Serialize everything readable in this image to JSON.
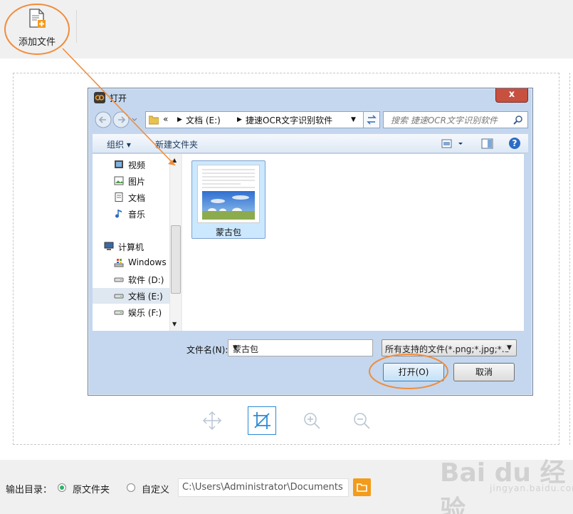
{
  "toolbar": {
    "add_file_label": "添加文件"
  },
  "dialog": {
    "title": "打开",
    "close_label": "x",
    "address": {
      "prefix": "«",
      "drive": "文档 (E:)",
      "folder": "捷速OCR文字识别软件"
    },
    "search_placeholder": "搜索 捷速OCR文字识别软件",
    "organize_label": "组织 ▾",
    "new_folder_label": "新建文件夹",
    "nav_items": [
      {
        "label": "视频",
        "icon": "video-icon"
      },
      {
        "label": "图片",
        "icon": "picture-icon"
      },
      {
        "label": "文档",
        "icon": "document-icon"
      },
      {
        "label": "音乐",
        "icon": "music-icon"
      },
      {
        "label": "计算机",
        "icon": "computer-icon"
      },
      {
        "label": "Windows",
        "icon": "windows-drive-icon"
      },
      {
        "label": "软件 (D:)",
        "icon": "drive-icon"
      },
      {
        "label": "文档 (E:)",
        "icon": "drive-icon",
        "selected": true
      },
      {
        "label": "娱乐 (F:)",
        "icon": "drive-icon"
      }
    ],
    "file": {
      "name": "蒙古包"
    },
    "filename_label": "文件名(N):",
    "filename_value": "蒙古包",
    "filter_value": "所有支持的文件(*.png;*.jpg;*.b",
    "open_button": "打开(O)",
    "cancel_button": "取消"
  },
  "bottom": {
    "output_label": "输出目录：",
    "option_original": "原文件夹",
    "option_custom": "自定义",
    "selected_option": "原文件夹",
    "path_value": "C:\\Users\\Administrator\\Documents"
  },
  "watermark": {
    "brand": "Bai du 经验",
    "url": "jingyan.baidu.com"
  },
  "colors": {
    "highlight": "#f08d3c",
    "accent": "#2a8ad6",
    "radio_selected": "#2db36a",
    "folder_button": "#f39b1b"
  }
}
